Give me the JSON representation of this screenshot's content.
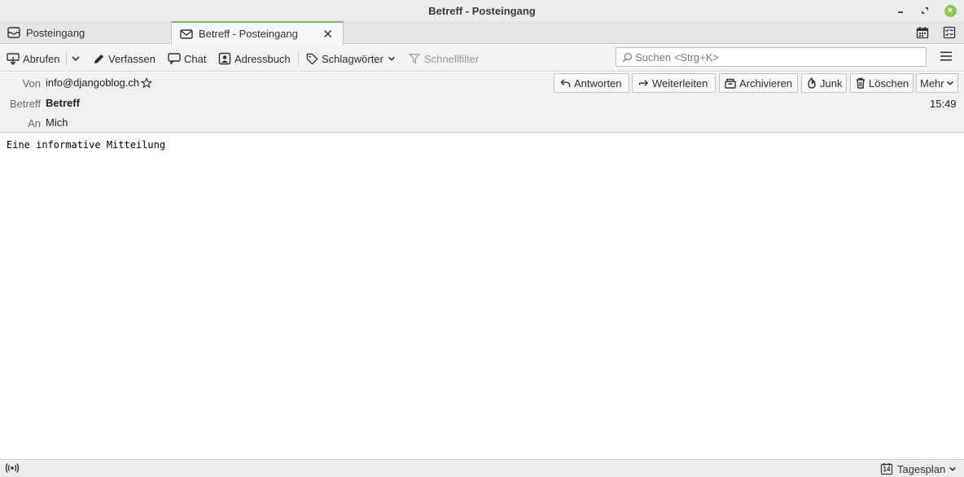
{
  "window": {
    "title": "Betreff - Posteingang"
  },
  "tabs": [
    {
      "label": "Posteingang",
      "icon": "inbox-icon",
      "active": false
    },
    {
      "label": "Betreff - Posteingang",
      "icon": "envelope-icon",
      "active": true
    }
  ],
  "toolbar": {
    "get_messages": "Abrufen",
    "write": "Verfassen",
    "chat": "Chat",
    "address_book": "Adressbuch",
    "tags": "Schlagwörter",
    "quick_filter": "Schnellfilter",
    "search_placeholder": "Suchen <Strg+K>"
  },
  "header": {
    "from_label": "Von",
    "from_value": "info@djangoblog.ch",
    "subject_label": "Betreff",
    "subject_value": "Betreff",
    "to_label": "An",
    "to_value": "Mich",
    "time": "15:49",
    "buttons": {
      "reply": "Antworten",
      "forward": "Weiterleiten",
      "archive": "Archivieren",
      "junk": "Junk",
      "delete": "Löschen",
      "more": "Mehr"
    }
  },
  "message": {
    "body": "Eine informative Mitteilung"
  },
  "statusbar": {
    "today_pane": "Tagesplan",
    "today_day": "14"
  },
  "colors": {
    "active_tab_accent": "#86b463",
    "close_button": "#8fc65a"
  }
}
